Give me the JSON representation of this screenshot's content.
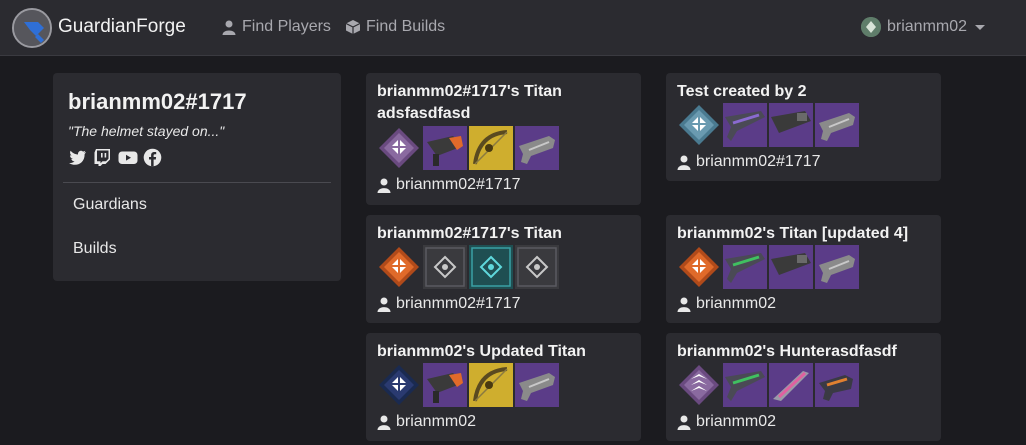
{
  "nav": {
    "brand": "GuardianForge",
    "links": [
      {
        "label": "Find Players",
        "icon": "user-icon"
      },
      {
        "label": "Find Builds",
        "icon": "cube-icon"
      }
    ],
    "user": "brianmm02"
  },
  "profile": {
    "name": "brianmm02#1717",
    "quote": "\"The helmet stayed on...\"",
    "socials": [
      "twitter-icon",
      "twitch-icon",
      "youtube-icon",
      "facebook-icon"
    ],
    "menu": [
      "Guardians",
      "Builds"
    ]
  },
  "builds": [
    {
      "title_lines": [
        "brianmm02#1717's Titan",
        "adsfasdfasd"
      ],
      "icons": [
        "titan-class-icon-purple",
        "weapon-icon-orange-rocket",
        "weapon-icon-yellow-bow",
        "weapon-icon-grey-gun"
      ],
      "owner": "brianmm02#1717"
    },
    {
      "title_lines": [
        "Test created by 2"
      ],
      "icons": [
        "titan-class-icon-blue",
        "weapon-icon-purple-rifle",
        "weapon-icon-grey-launcher",
        "weapon-icon-grey-gun"
      ],
      "owner": "brianmm02#1717"
    },
    {
      "title_lines": [
        "brianmm02#1717's Titan"
      ],
      "icons": [
        "titan-class-icon-orange",
        "empty-slot-icon",
        "empty-slot-icon-cyan",
        "empty-slot-icon"
      ],
      "owner": "brianmm02#1717"
    },
    {
      "title_lines": [
        "brianmm02's Titan [updated 4]"
      ],
      "icons": [
        "titan-class-icon-orange",
        "weapon-icon-green-rifle",
        "weapon-icon-red-launcher",
        "weapon-icon-grey-gun"
      ],
      "owner": "brianmm02"
    },
    {
      "title_lines": [
        "brianmm02's Updated Titan"
      ],
      "icons": [
        "titan-class-icon-navy",
        "weapon-icon-orange-rocket",
        "weapon-icon-yellow-bow",
        "weapon-icon-grey-gun"
      ],
      "owner": "brianmm02"
    },
    {
      "title_lines": [
        "brianmm02's Hunterasdfasdf"
      ],
      "icons": [
        "hunter-class-icon",
        "weapon-icon-green-rifle",
        "weapon-icon-pink-sword",
        "weapon-icon-orange-smg"
      ],
      "owner": "brianmm02"
    }
  ],
  "colors": {
    "background": "#1b1b1f",
    "card": "#2b2b30",
    "purple_tile": "#5b3c88",
    "yellow_tile": "#cfae2e",
    "orange_class": "#e06a2a"
  }
}
